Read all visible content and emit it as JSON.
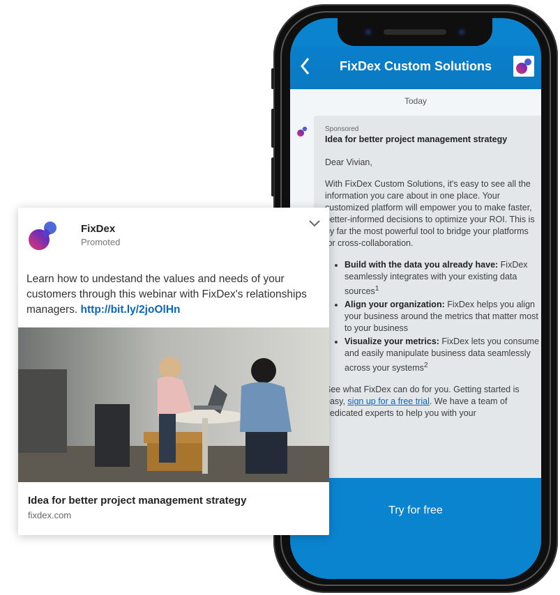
{
  "phone": {
    "header": {
      "title": "FixDex Custom Solutions",
      "back_icon": "chevron-left-icon",
      "logo_icon": "fixdex-logo-icon"
    },
    "chat": {
      "day_label": "Today",
      "message": {
        "sponsored_label": "Sponsored",
        "title": "Idea for better project management strategy",
        "greeting": "Dear Vivian,",
        "paragraph1": "With FixDex Custom Solutions, it's easy to see all the information you care about in one place. Your customized platform will empower you to make faster, better-informed decisions to optimize your ROI. This is by far the most powerful tool to bridge your platforms for cross-collaboration.",
        "bullets": [
          {
            "heading": "Build with the data you already have:",
            "text": " FixDex seamlessly integrates with your existing data sources",
            "sup": "1"
          },
          {
            "heading": "Align your organization:",
            "text": " FixDex helps you align your business around the metrics that matter most to your business",
            "sup": ""
          },
          {
            "heading": "Visualize your metrics:",
            "text": " FixDex lets you consume and easily manipulate business data seamlessly across your systems",
            "sup": "2"
          }
        ],
        "closing_prefix": "See what FixDex can do for you.  Getting started is easy, ",
        "closing_link": "sign up for a free trial",
        "closing_suffix": ". We have a team of dedicated experts to help you with your"
      }
    },
    "cta_label": "Try for free"
  },
  "post": {
    "company": "FixDex",
    "promoted_label": "Promoted",
    "text": "Learn how to undestand the values and needs of your customers through this webinar with FixDex's relationships managers. ",
    "link": "http://bit.ly/2joOlHn",
    "headline": "Idea for better project management strategy",
    "domain": "fixdex.com",
    "menu_icon": "chevron-down-icon",
    "image_icon": "photo-two-women-at-laptop"
  },
  "colors": {
    "brand_blue": "#0b84d0",
    "link_blue": "#0a66c2",
    "logo_pink": "#e8356d",
    "logo_purple": "#4d2ac6"
  }
}
